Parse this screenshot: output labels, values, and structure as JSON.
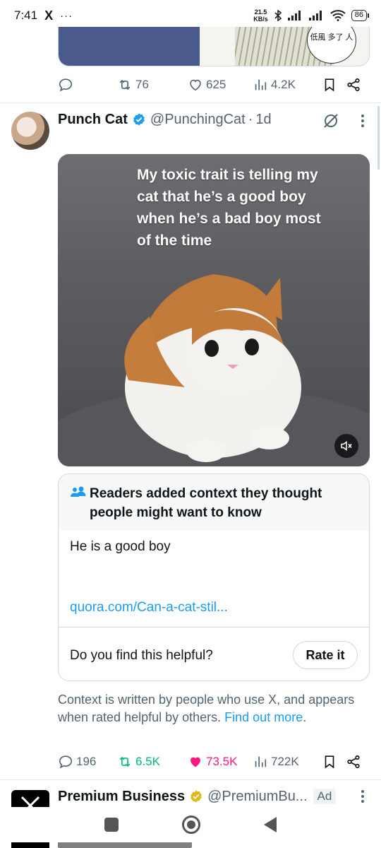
{
  "status_bar": {
    "time": "7:41",
    "app_glyph": "X",
    "dots": "···",
    "speed_value": "21.5",
    "speed_unit": "KB/s",
    "battery": "86"
  },
  "previous_tweet": {
    "image_text": "低風 多了 人",
    "actions": {
      "comments": "",
      "reposts": "76",
      "likes": "625",
      "views": "4.2K"
    }
  },
  "tweet": {
    "display_name": "Punch Cat",
    "handle": "@PunchingCat",
    "separator": "·",
    "time": "1d",
    "media_caption": "My toxic trait is telling my cat that he’s a good boy when he’s a bad boy most of the time",
    "note": {
      "title": "Readers added context they thought people might want to know",
      "text": "He is a good boy",
      "link": "quora.com/Can-a-cat-stil...",
      "question": "Do you find this helpful?",
      "rate_label": "Rate it"
    },
    "context_info": {
      "text": "Context is written by people who use X, and appears when rated helpful by others. ",
      "link": "Find out more",
      "end": "."
    },
    "actions": {
      "comments": "196",
      "reposts": "6.5K",
      "likes": "73.5K",
      "views": "722K"
    }
  },
  "next_tweet": {
    "display_name": "Premium Business",
    "handle": "@PremiumBu...",
    "ad_label": "Ad"
  },
  "colors": {
    "accent": "#1d9bf0",
    "repost_active": "#00ba7c",
    "like_active": "#f91880",
    "secondary_text": "#536471"
  },
  "icons": [
    "comment-icon",
    "repost-icon",
    "heart-icon",
    "views-icon",
    "bookmark-icon",
    "share-icon",
    "verified-icon",
    "grok-icon",
    "more-icon",
    "mute-icon",
    "people-icon"
  ]
}
